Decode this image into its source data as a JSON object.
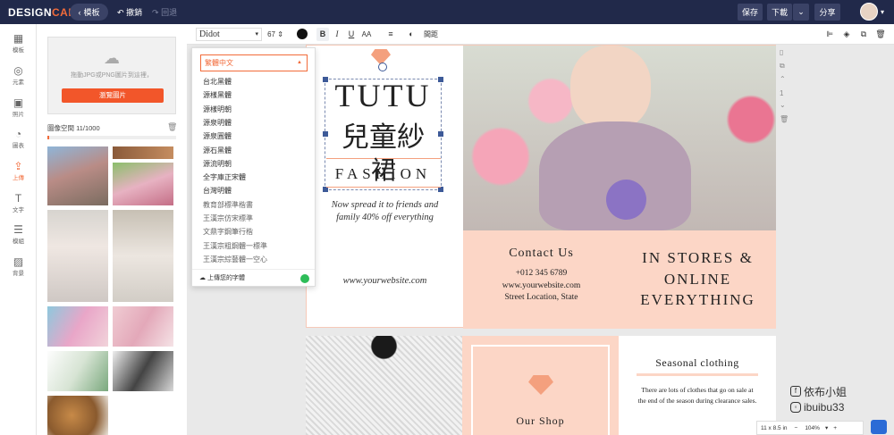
{
  "app": {
    "logo_a": "DESIGN",
    "logo_b": "CAP"
  },
  "topbar": {
    "back_label": "模板",
    "undo_label": "撤銷",
    "redo_label": "回退",
    "save_label": "保存",
    "download_label": "下載",
    "share_label": "分享"
  },
  "sidebar": {
    "items": [
      {
        "icon": "template-icon",
        "label": "模板"
      },
      {
        "icon": "element-icon",
        "label": "元素"
      },
      {
        "icon": "photo-icon",
        "label": "照片"
      },
      {
        "icon": "chart-icon",
        "label": "圖表"
      },
      {
        "icon": "upload-icon",
        "label": "上傳"
      },
      {
        "icon": "text-icon",
        "label": "文字"
      },
      {
        "icon": "template-list-icon",
        "label": "模組"
      },
      {
        "icon": "background-icon",
        "label": "背景"
      }
    ]
  },
  "upload_panel": {
    "hint": "拖動JPG或PNG圖片到這裡，",
    "button_label": "瀏覽圖片",
    "storage_label": "圖像空間 11/1000",
    "storage_fraction": 0.011
  },
  "toolbar": {
    "font_name": "Didot",
    "font_size": "67",
    "bold": "B",
    "italic": "I",
    "underline": "U",
    "case": "AA",
    "spacing_label": "間距"
  },
  "font_dropdown": {
    "selected": "繁體中文",
    "items": [
      "台北黑體",
      "源樣黑體",
      "源樣明朝",
      "源泉明體",
      "源泉圓體",
      "源石黑體",
      "源流明朝",
      "全字庫正宋體",
      "台灣明體",
      "教育部標準楷書",
      "王漢宗仿宋標準",
      "文鼎字鋼筆行楷",
      "王漢宗粗鋼體一標準",
      "王漢宗綜藝體一空心"
    ],
    "upload_label": "上傳您的字體"
  },
  "design": {
    "title_line1": "TUTU",
    "title_line2": "兒童紗",
    "title_line3": "FASHION",
    "title_overlay": "裙",
    "tagline_1": "Now spread it to friends and",
    "tagline_2": "family 40% off everything",
    "website": "www.yourwebsite.com",
    "contact_title": "Contact Us",
    "phone": "+012 345 6789",
    "contact_web": "www.yourwebsite.com",
    "address": "Street Location, State",
    "promo_1": "IN STORES &",
    "promo_2": "ONLINE",
    "promo_3": "EVERYTHING",
    "shop_label": "Our Shop",
    "seasonal_title": "Seasonal clothing",
    "seasonal_body": "There are lots of clothes that go on sale at the end of the season during clearance sales."
  },
  "right_rail": {
    "page_number": "1"
  },
  "status": {
    "page_size": "11 x 8.5 in",
    "zoom": "104%"
  },
  "watermark": {
    "fb": "依布小姐",
    "ig": "ibuibu33"
  },
  "colors": {
    "accent": "#f26b3a",
    "topbar": "#21294a",
    "peach": "#fcd6c6"
  }
}
